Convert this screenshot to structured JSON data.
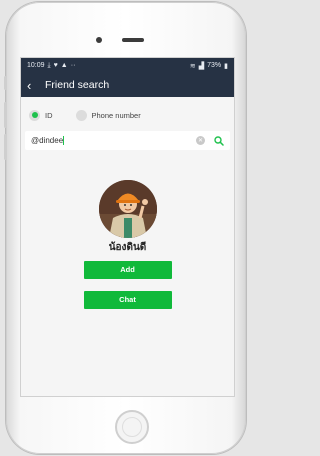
{
  "status_bar": {
    "time": "10:09",
    "left_icons": [
      "download-icon",
      "heart-icon",
      "warning-icon",
      "dots-icon"
    ],
    "right_text": "73%"
  },
  "header": {
    "title": "Friend search"
  },
  "search_type": {
    "options": [
      {
        "label": "ID",
        "selected": true
      },
      {
        "label": "Phone number",
        "selected": false
      }
    ]
  },
  "search": {
    "value": "@dindee"
  },
  "result": {
    "name": "น้องดินดี",
    "add_label": "Add",
    "chat_label": "Chat"
  },
  "colors": {
    "header_bg": "#263244",
    "accent_green": "#10b93a",
    "radio_green": "#1fc14d"
  }
}
